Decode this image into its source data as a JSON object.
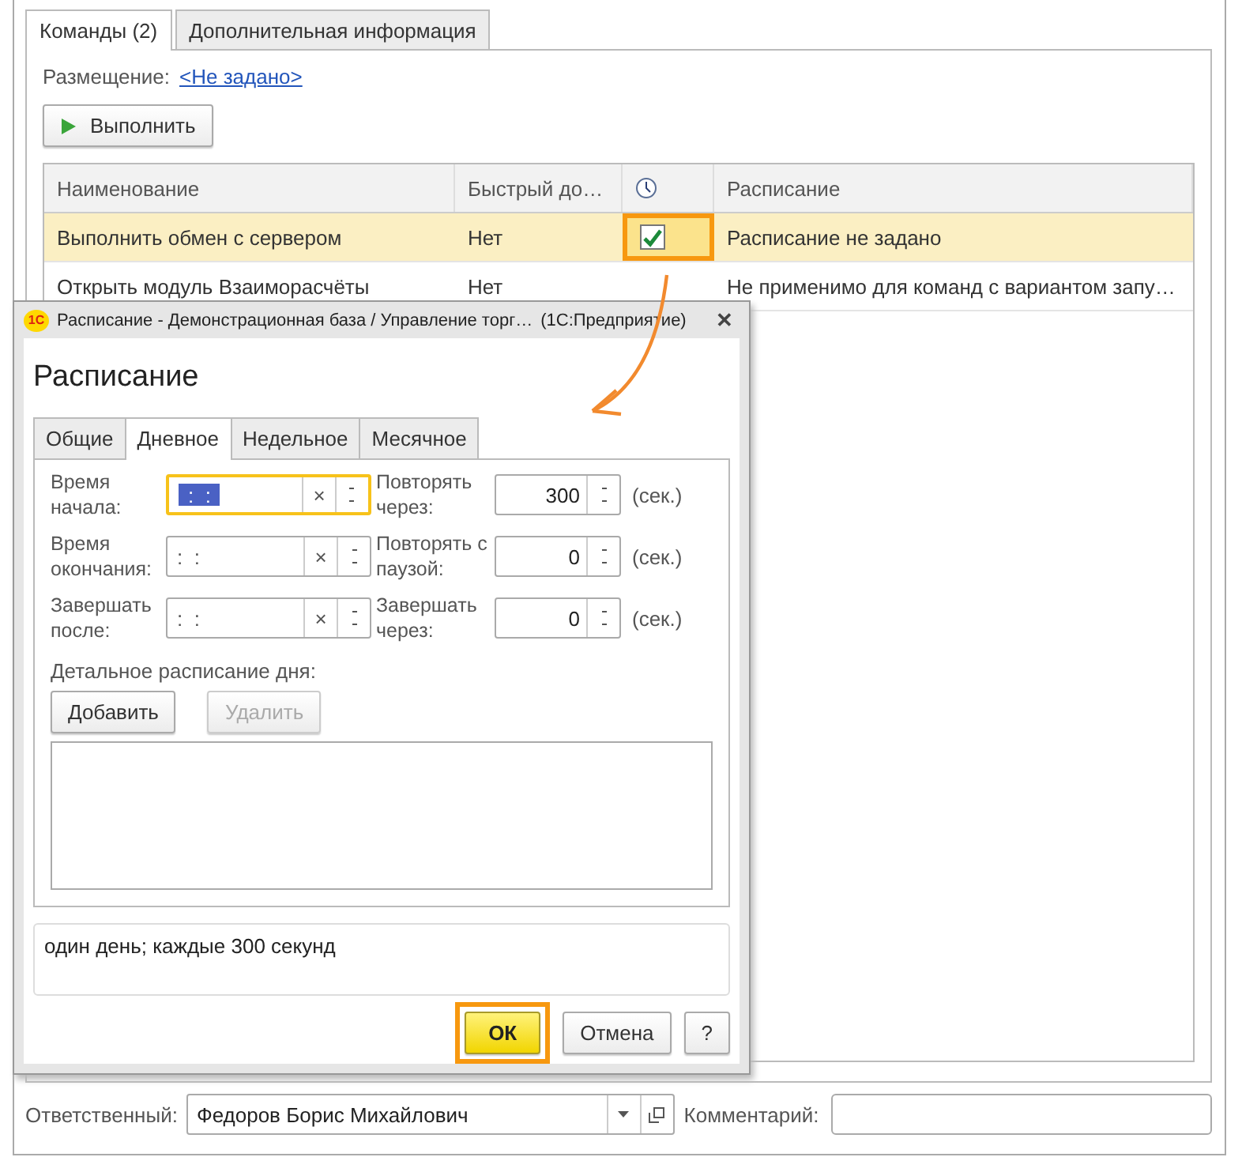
{
  "tabs": [
    {
      "label": "Команды (2)",
      "selected": true
    },
    {
      "label": "Дополнительная информация",
      "selected": false
    }
  ],
  "placement": {
    "label": "Размещение:",
    "value": "<Не задано>"
  },
  "run_button": {
    "label": "Выполнить"
  },
  "table": {
    "columns": [
      {
        "kind": "text",
        "label": "Наименование"
      },
      {
        "kind": "text",
        "label": "Быстрый до…"
      },
      {
        "kind": "clock"
      },
      {
        "kind": "text",
        "label": "Расписание"
      }
    ],
    "rows": [
      {
        "name": "Выполнить обмен с сервером",
        "quick": "Нет",
        "has_checkbox": true,
        "checked": true,
        "highlighted": true,
        "schedule": "Расписание не задано",
        "selected": true
      },
      {
        "name": "Открыть модуль Взаиморасчёты",
        "quick": "Нет",
        "has_checkbox": false,
        "highlighted": false,
        "schedule": "Не применимо для команд с вариантом запу…",
        "selected": false
      }
    ]
  },
  "dialog": {
    "logo": "1С",
    "title": "Расписание - Демонстрационная база / Управление торг…",
    "app": "(1С:Предприятие)",
    "close": "✕",
    "heading": "Расписание",
    "tabs": [
      {
        "label": "Общие",
        "selected": false
      },
      {
        "label": "Дневное",
        "selected": true
      },
      {
        "label": "Недельное",
        "selected": false
      },
      {
        "label": "Месячное",
        "selected": false
      }
    ],
    "time_fields": [
      {
        "label": "Время начала:",
        "value": ":  :",
        "clear": "×",
        "focused": true
      },
      {
        "label": "Время окончания:",
        "value": ":  :",
        "clear": "×",
        "focused": false
      },
      {
        "label": "Завершать после:",
        "value": ":  :",
        "clear": "×",
        "focused": false
      }
    ],
    "number_fields": [
      {
        "label": "Повторять через:",
        "value": "300",
        "unit": "(сек.)"
      },
      {
        "label": "Повторять с паузой:",
        "value": "0",
        "unit": "(сек.)"
      },
      {
        "label": "Завершать через:",
        "value": "0",
        "unit": "(сек.)"
      }
    ],
    "detail_label": "Детальное расписание дня:",
    "detail_buttons": [
      {
        "label": "Добавить",
        "disabled": false
      },
      {
        "label": "Удалить",
        "disabled": true
      }
    ],
    "summary": "один день; каждые 300 секунд",
    "buttons": [
      {
        "label": "ОК",
        "kind": "default",
        "highlighted": true
      },
      {
        "label": "Отмена",
        "kind": "normal",
        "highlighted": false
      },
      {
        "label": "?",
        "kind": "normal",
        "highlighted": false
      }
    ]
  },
  "responsible": {
    "label": "Ответственный:",
    "value": "Федоров Борис Михайлович"
  },
  "comment": {
    "label": "Комментарий:"
  }
}
